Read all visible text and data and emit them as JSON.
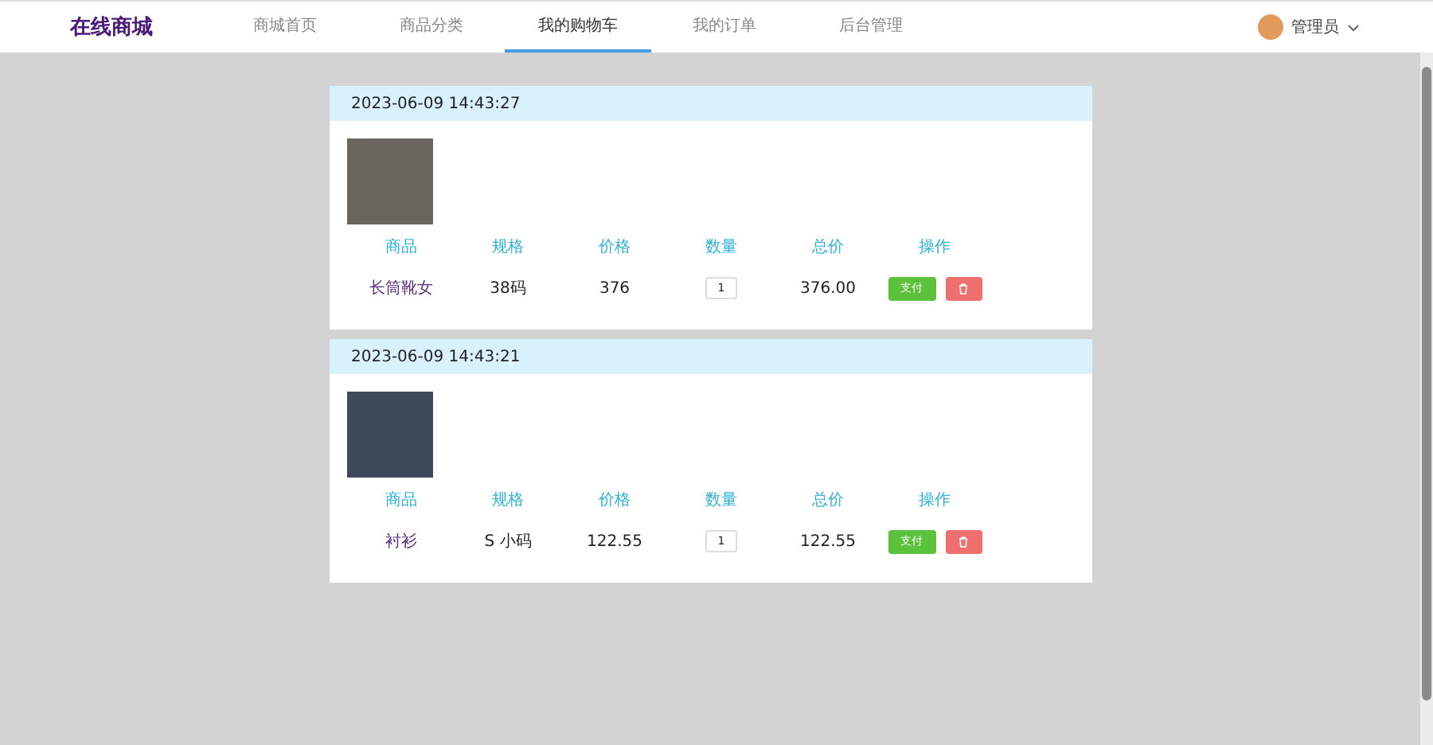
{
  "header": {
    "logo": "在线商城",
    "nav": [
      {
        "label": "商城首页",
        "selected": false
      },
      {
        "label": "商品分类",
        "selected": false
      },
      {
        "label": "我的购物车",
        "selected": true
      },
      {
        "label": "我的订单",
        "selected": false
      },
      {
        "label": "后台管理",
        "selected": false
      }
    ],
    "user": "管理员"
  },
  "orders": [
    {
      "time": "2023-06-09 14:43:27",
      "columns": [
        "商品",
        "规格",
        "价格",
        "数量",
        "总价",
        "操作"
      ],
      "product": "长筒靴女",
      "spec": "38码",
      "price": "376",
      "quantity": "1",
      "total": "376.00",
      "pay_label": "支付"
    },
    {
      "time": "2023-06-09 14:43:21",
      "columns": [
        "商品",
        "规格",
        "价格",
        "数量",
        "总价",
        "操作"
      ],
      "product": "衬衫",
      "spec": "S 小码",
      "price": "122.55",
      "quantity": "1",
      "total": "122.55",
      "pay_label": "支付"
    }
  ]
}
